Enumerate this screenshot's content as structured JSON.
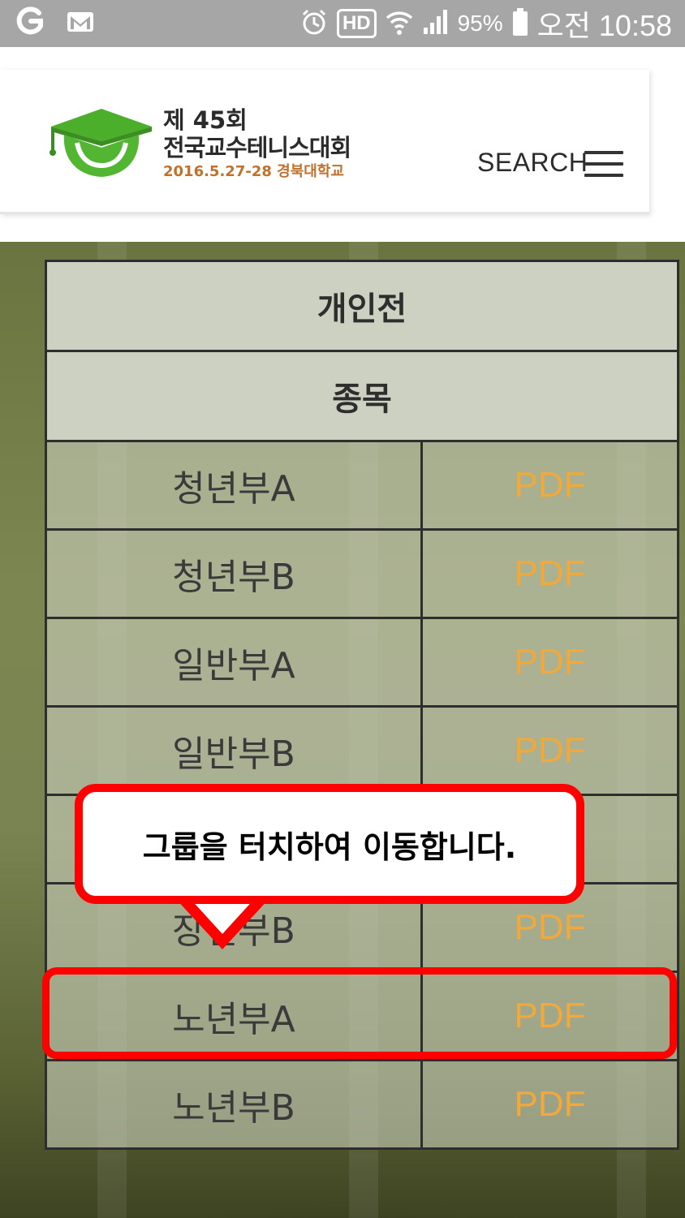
{
  "status_bar": {
    "battery": "95%",
    "time": "오전 10:58",
    "hd_label": "HD",
    "icons": [
      "g-icon",
      "gmail-icon",
      "alarm-icon",
      "hd-voice-icon",
      "wifi-icon",
      "signal-icon",
      "battery-icon"
    ]
  },
  "header": {
    "logo_line1": "제 45회",
    "logo_line2": "전국교수테니스대회",
    "logo_line3": "2016.5.27-28 경북대학교",
    "search_label": "SEARCH"
  },
  "table": {
    "title": "개인전",
    "subheader": "종목",
    "rows": [
      {
        "name": "청년부A",
        "link": "PDF"
      },
      {
        "name": "청년부B",
        "link": "PDF"
      },
      {
        "name": "일반부A",
        "link": "PDF"
      },
      {
        "name": "일반부B",
        "link": "PDF"
      },
      {
        "name": "",
        "link": ""
      },
      {
        "name": "장년부B",
        "link": "PDF"
      },
      {
        "name": "노년부A",
        "link": "PDF"
      },
      {
        "name": "노년부B",
        "link": "PDF"
      }
    ]
  },
  "tooltip": {
    "text": "그룹을 터치하여 이동합니다."
  },
  "colors": {
    "accent_red": "#ff0000",
    "pdf_link": "#f0a93a",
    "logo_green": "#4caf2c",
    "logo_date": "#c0712c"
  }
}
